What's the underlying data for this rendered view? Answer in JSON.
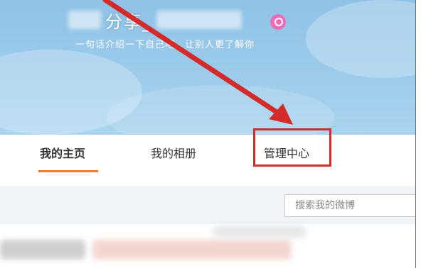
{
  "profile": {
    "name_visible": "分享_",
    "name_suffix": "",
    "intro": "一句话介绍一下自己吧，让别人更了解你",
    "gender_icon": "female-icon"
  },
  "nav": {
    "tabs": [
      {
        "label": "我的主页",
        "active": true
      },
      {
        "label": "我的相册",
        "active": false
      },
      {
        "label": "管理中心",
        "active": false,
        "highlighted": true
      }
    ]
  },
  "search": {
    "placeholder": "搜索我的微博"
  },
  "colors": {
    "banner": "#9ccbeb",
    "active_underline": "#f07b3f",
    "annotation_red": "#d42a2a",
    "gender_pink": "#f06bb8"
  },
  "watermark": ""
}
